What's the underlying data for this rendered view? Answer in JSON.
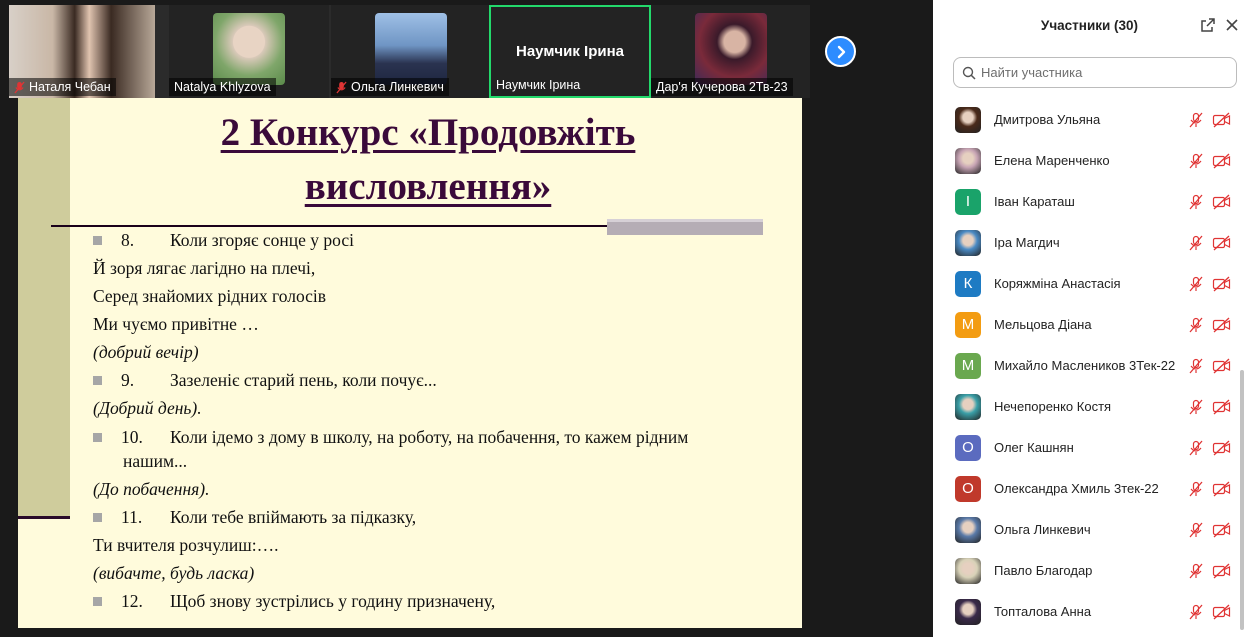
{
  "thumbnails": [
    {
      "name": "Наталя Чебан",
      "muted": true,
      "photo_colors": [
        "#c9b7a6",
        "#3a2a22"
      ]
    },
    {
      "name": "Natalya Khlyzova",
      "muted": false,
      "photo_colors": [
        "#7fa66a",
        "#d9c9b9"
      ]
    },
    {
      "name": "Ольга Линкевич",
      "muted": true,
      "photo_colors": [
        "#6f95c4",
        "#2a3350"
      ]
    },
    {
      "name": "Наумчик Ірина",
      "muted": false,
      "label_big": "Наумчик Ірина",
      "active": true
    },
    {
      "name": "Дар'я Кучерова 2Тв-23",
      "muted": false,
      "photo_colors": [
        "#7a2a3a",
        "#3c2a5a"
      ]
    }
  ],
  "slide": {
    "title_line1": "2 Конкурс «Продовжіть",
    "title_line2": "висловлення»",
    "lines": [
      {
        "num": "8.",
        "text": "Коли згоряє сонце у росі"
      },
      {
        "text": "Й зоря лягає лагідно на плечі,"
      },
      {
        "text": "Серед знайомих рідних голосів"
      },
      {
        "text": "Ми чуємо привітне …"
      },
      {
        "text": "(добрий вечір)"
      },
      {
        "num": "9.",
        "text": "Зазеленіє старий пень, коли почує..."
      },
      {
        "text": "(Добрий день)."
      },
      {
        "num": "10.",
        "text": "Коли ідемо з дому в школу, на роботу, на побачення, то кажем рідним"
      },
      {
        "text": "нашим..."
      },
      {
        "text": "(До побачення)."
      },
      {
        "num": "11.",
        "text": "Коли тебе впіймають за підказку,"
      },
      {
        "text": "Ти вчителя розчулиш:…."
      },
      {
        "text": "(вибачте, будь ласка)"
      },
      {
        "num": "12.",
        "text": "Щоб знову зустрілись у годину призначену,"
      }
    ]
  },
  "panel": {
    "title": "Участники (30)",
    "search_placeholder": "Найти участника",
    "participants": [
      {
        "name": "Дмитрова Ульяна",
        "avatar_type": "photo",
        "color": "#4a2a1a"
      },
      {
        "name": "Елена Маренченко",
        "avatar_type": "photo",
        "color": "#c7a4b4"
      },
      {
        "name": "Іван Караташ",
        "avatar_type": "letter",
        "letter": "І",
        "color": "#1aa36a"
      },
      {
        "name": "Іра Магдич",
        "avatar_type": "photo",
        "color": "#4a8ac4"
      },
      {
        "name": "Коряжміна Анастасія",
        "avatar_type": "letter",
        "letter": "К",
        "color": "#1e7bc3"
      },
      {
        "name": "Мельцова Діана",
        "avatar_type": "letter",
        "letter": "М",
        "color": "#f39c12"
      },
      {
        "name": "Михайло Маслеников 3Тек-22",
        "avatar_type": "letter",
        "letter": "М",
        "color": "#6aa84f"
      },
      {
        "name": "Нечепоренко Костя",
        "avatar_type": "photo",
        "color": "#3aa0a8"
      },
      {
        "name": "Олег Кашнян",
        "avatar_type": "letter",
        "letter": "О",
        "color": "#5b6bbf"
      },
      {
        "name": "Олександра Хмиль 3тек-22",
        "avatar_type": "letter",
        "letter": "О",
        "color": "#c0392b"
      },
      {
        "name": "Ольга Линкевич",
        "avatar_type": "photo",
        "color": "#5a7aa8"
      },
      {
        "name": "Павло Благодар",
        "avatar_type": "photo",
        "color": "#d8d2b8"
      },
      {
        "name": "Топталова Анна",
        "avatar_type": "photo",
        "color": "#3a2a4a"
      }
    ]
  }
}
